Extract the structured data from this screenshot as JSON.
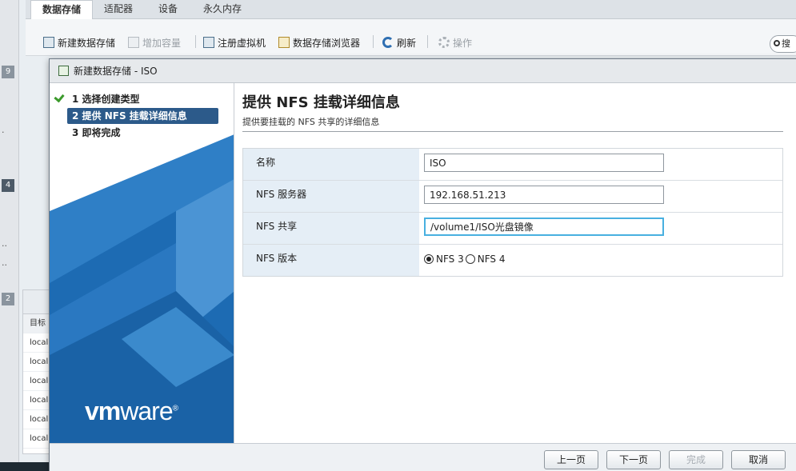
{
  "background": {
    "tabs": [
      "数据存储",
      "适配器",
      "设备",
      "永久内存"
    ],
    "toolbar": {
      "new_datastore": "新建数据存储",
      "increase_capacity": "增加容量",
      "register_vm": "注册虚拟机",
      "datastore_browser": "数据存储浏览器",
      "refresh": "刷新",
      "actions": "操作"
    },
    "search_placeholder": "搜",
    "left_numbers": [
      "9",
      "4",
      "2"
    ],
    "lower_panel": {
      "header_label": "目标",
      "rows": [
        "local",
        "local",
        "local",
        "local",
        "local",
        "local"
      ]
    }
  },
  "dialog": {
    "title": "新建数据存储 - ISO",
    "steps": [
      {
        "label": "1 选择创建类型",
        "done": true
      },
      {
        "label": "2 提供 NFS 挂载详细信息",
        "current": true
      },
      {
        "label": "3 即将完成"
      }
    ],
    "logo": {
      "bold": "vm",
      "rest": "ware",
      "mark": "®"
    },
    "heading": "提供 NFS 挂载详细信息",
    "subheading": "提供要挂载的 NFS 共享的详细信息",
    "fields": {
      "name": {
        "label": "名称",
        "value": "ISO"
      },
      "server": {
        "label": "NFS 服务器",
        "value": "192.168.51.213"
      },
      "share": {
        "label": "NFS 共享",
        "value": "/volume1/ISO光盘镜像"
      },
      "version": {
        "label": "NFS 版本",
        "options": [
          "NFS 3",
          "NFS 4"
        ],
        "selected": "NFS 3"
      }
    },
    "buttons": {
      "back": "上一页",
      "next": "下一页",
      "finish": "完成",
      "cancel": "取消"
    }
  },
  "colors": {
    "accent": "#2c5a8a",
    "nav_blue": "#2f7fc6",
    "focus": "#48b0e0"
  }
}
